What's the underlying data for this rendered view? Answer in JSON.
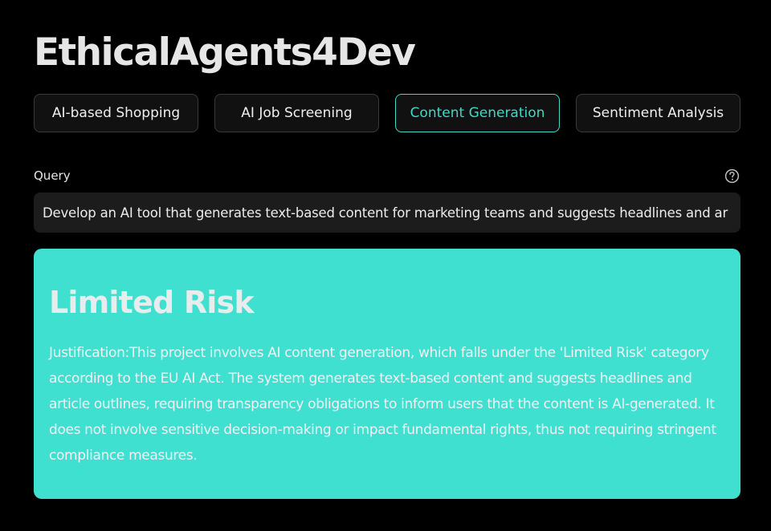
{
  "app": {
    "title": "EthicalAgents4Dev"
  },
  "tabs": [
    {
      "label": "AI-based Shopping",
      "active": false
    },
    {
      "label": "AI Job Screening",
      "active": false
    },
    {
      "label": "Content Generation",
      "active": true
    },
    {
      "label": "Sentiment Analysis",
      "active": false
    }
  ],
  "query": {
    "label": "Query",
    "value": "Develop an AI tool that generates text-based content for marketing teams and suggests headlines and ar",
    "help_icon": "question-circle-icon"
  },
  "result": {
    "title": "Limited Risk",
    "justification": "Justification:This project involves AI content generation, which falls under the 'Limited Risk' category according to the EU AI Act. The system generates text-based content and suggests headlines and article outlines, requiring transparency obligations to inform users that the content is AI-generated. It does not involve sensitive decision-making or impact fundamental rights, thus not requiring stringent compliance measures."
  },
  "colors": {
    "background": "#000000",
    "accent": "#3fd9c6",
    "card": "#40e0d0",
    "input_bg": "#1c1c1c"
  }
}
